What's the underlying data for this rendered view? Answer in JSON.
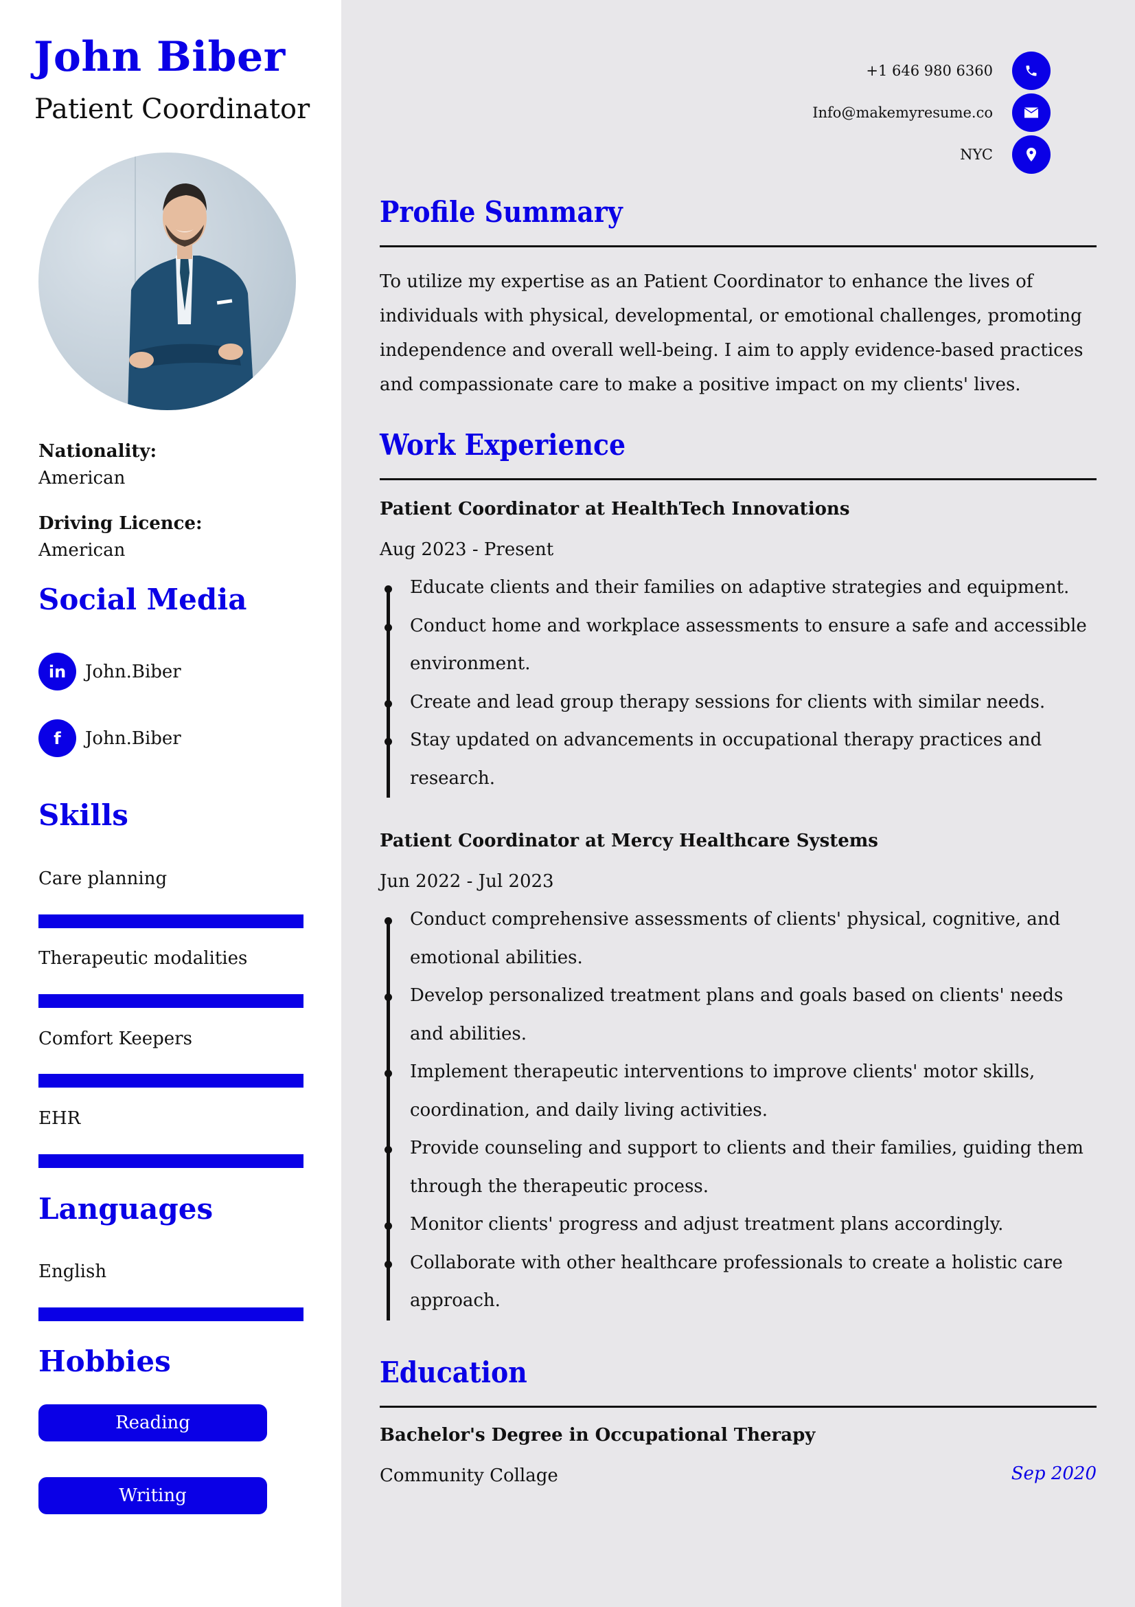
{
  "header": {
    "name": "John Biber",
    "title": "Patient Coordinator"
  },
  "photo": {
    "alt": "Portrait of man in blue suit with arms crossed"
  },
  "personal": {
    "nationality_label": "Nationality:",
    "nationality_value": "American",
    "licence_label": "Driving Licence:",
    "licence_value": "American"
  },
  "social": {
    "heading": "Social Media",
    "items": [
      {
        "icon": "linkedin-icon",
        "glyph": "in",
        "handle": "John.Biber"
      },
      {
        "icon": "facebook-icon",
        "glyph": "f",
        "handle": "John.Biber"
      }
    ]
  },
  "skills": {
    "heading": "Skills",
    "items": [
      {
        "label": "Care planning",
        "level": 1.0
      },
      {
        "label": "Therapeutic modalities",
        "level": 1.0
      },
      {
        "label": "Comfort Keepers",
        "level": 1.0
      },
      {
        "label": "EHR",
        "level": 1.0
      }
    ]
  },
  "languages": {
    "heading": "Languages",
    "items": [
      {
        "label": "English",
        "level": 1.0
      }
    ]
  },
  "hobbies": {
    "heading": "Hobbies",
    "items": [
      "Reading",
      "Writing"
    ]
  },
  "contact": {
    "phone": "+1 646 980 6360",
    "email": "Info@makemyresume.co",
    "location": "NYC"
  },
  "profile": {
    "heading": "Profile Summary",
    "text": "To utilize my expertise as an Patient Coordinator to enhance the lives of individuals with physical, developmental, or emotional challenges, promoting independence and overall well-being. I aim to apply evidence-based practices and compassionate care to make a positive impact on my clients' lives."
  },
  "experience": {
    "heading": "Work Experience",
    "jobs": [
      {
        "title": "Patient Coordinator at HealthTech Innovations",
        "dates": "Aug 2023 - Present",
        "bullets": [
          "Educate clients and their families on adaptive strategies and equipment.",
          "Conduct home and workplace assessments to ensure a safe and accessible environment.",
          "Create and lead group therapy sessions for clients with similar needs.",
          "Stay updated on advancements in occupational therapy practices and research."
        ]
      },
      {
        "title": "Patient Coordinator at Mercy Healthcare Systems",
        "dates": "Jun 2022 - Jul 2023",
        "bullets": [
          "Conduct comprehensive assessments of clients' physical, cognitive, and emotional abilities.",
          "Develop personalized treatment plans and goals based on clients' needs and abilities.",
          "Implement therapeutic interventions to improve clients' motor skills, coordination, and daily living activities.",
          "Provide counseling and support to clients and their families, guiding them through the therapeutic process.",
          "Monitor clients' progress and adjust treatment plans accordingly.",
          "Collaborate with other healthcare professionals to create a holistic care approach."
        ]
      }
    ]
  },
  "education": {
    "heading": "Education",
    "degree": "Bachelor's Degree in Occupational Therapy",
    "school": "Community Collage",
    "date": "Sep 2020"
  },
  "colors": {
    "accent": "#0a00e6",
    "sidebar_bg": "#ffffff",
    "main_bg": "#e8e7ea",
    "text": "#111111"
  }
}
